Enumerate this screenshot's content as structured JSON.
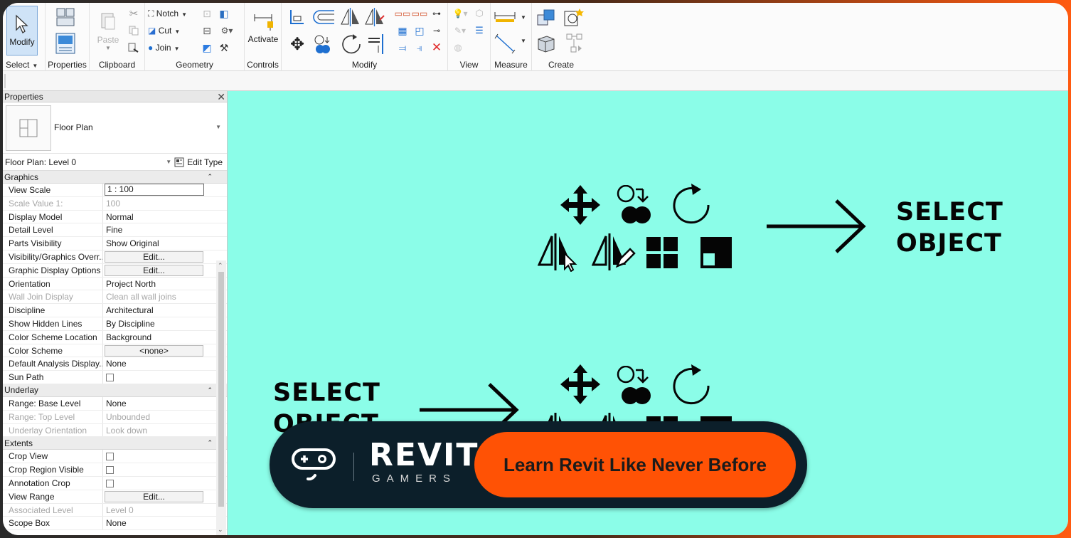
{
  "ribbon": {
    "modify_label": "Modify",
    "select_label": "Select",
    "properties_label": "Properties",
    "clipboard_label": "Clipboard",
    "paste_label": "Paste",
    "geometry_label": "Geometry",
    "notch_label": "Notch",
    "cut_label": "Cut",
    "join_label": "Join",
    "controls_label": "Controls",
    "activate_label": "Activate",
    "modify_panel_label": "Modify",
    "view_label": "View",
    "measure_label": "Measure",
    "create_label": "Create"
  },
  "properties": {
    "title": "Properties",
    "type_name": "Floor Plan",
    "instance": "Floor Plan: Level 0",
    "edit_type": "Edit Type",
    "groups": {
      "graphics": "Graphics",
      "underlay": "Underlay",
      "extents": "Extents"
    },
    "rows": {
      "view_scale": {
        "k": "View Scale",
        "v": "1 : 100"
      },
      "scale_value": {
        "k": "Scale Value    1:",
        "v": "100"
      },
      "display_model": {
        "k": "Display Model",
        "v": "Normal"
      },
      "detail_level": {
        "k": "Detail Level",
        "v": "Fine"
      },
      "parts_visibility": {
        "k": "Parts Visibility",
        "v": "Show Original"
      },
      "vg_overrides": {
        "k": "Visibility/Graphics Overr...",
        "v": "Edit..."
      },
      "graphic_display": {
        "k": "Graphic Display Options",
        "v": "Edit..."
      },
      "orientation": {
        "k": "Orientation",
        "v": "Project North"
      },
      "wall_join": {
        "k": "Wall Join Display",
        "v": "Clean all wall joins"
      },
      "discipline": {
        "k": "Discipline",
        "v": "Architectural"
      },
      "hidden_lines": {
        "k": "Show Hidden Lines",
        "v": "By Discipline"
      },
      "color_scheme_loc": {
        "k": "Color Scheme Location",
        "v": "Background"
      },
      "color_scheme": {
        "k": "Color Scheme",
        "v": "<none>"
      },
      "default_analysis": {
        "k": "Default Analysis Display...",
        "v": "None"
      },
      "sun_path": {
        "k": "Sun Path",
        "v": ""
      },
      "range_base": {
        "k": "Range: Base Level",
        "v": "None"
      },
      "range_top": {
        "k": "Range: Top Level",
        "v": "Unbounded"
      },
      "underlay_orient": {
        "k": "Underlay Orientation",
        "v": "Look down"
      },
      "crop_view": {
        "k": "Crop View",
        "v": ""
      },
      "crop_region": {
        "k": "Crop Region Visible",
        "v": ""
      },
      "annotation_crop": {
        "k": "Annotation Crop",
        "v": ""
      },
      "view_range": {
        "k": "View Range",
        "v": "Edit..."
      },
      "assoc_level": {
        "k": "Associated Level",
        "v": "Level 0"
      },
      "scope_box": {
        "k": "Scope Box",
        "v": "None"
      }
    }
  },
  "canvas": {
    "top_text_1": "SELECT",
    "top_text_2": "OBJECT",
    "bottom_text_1": "SELECT",
    "bottom_text_2": "OBJECT"
  },
  "banner": {
    "logo": "REVIT",
    "logo_sub": "GAMERS",
    "cta": "Learn Revit Like Never Before"
  },
  "colors": {
    "canvas_bg": "#8bfde8",
    "banner_bg": "#0c1f2a",
    "cta_bg": "#ff5205",
    "accent_blue": "#1e6fd0"
  }
}
